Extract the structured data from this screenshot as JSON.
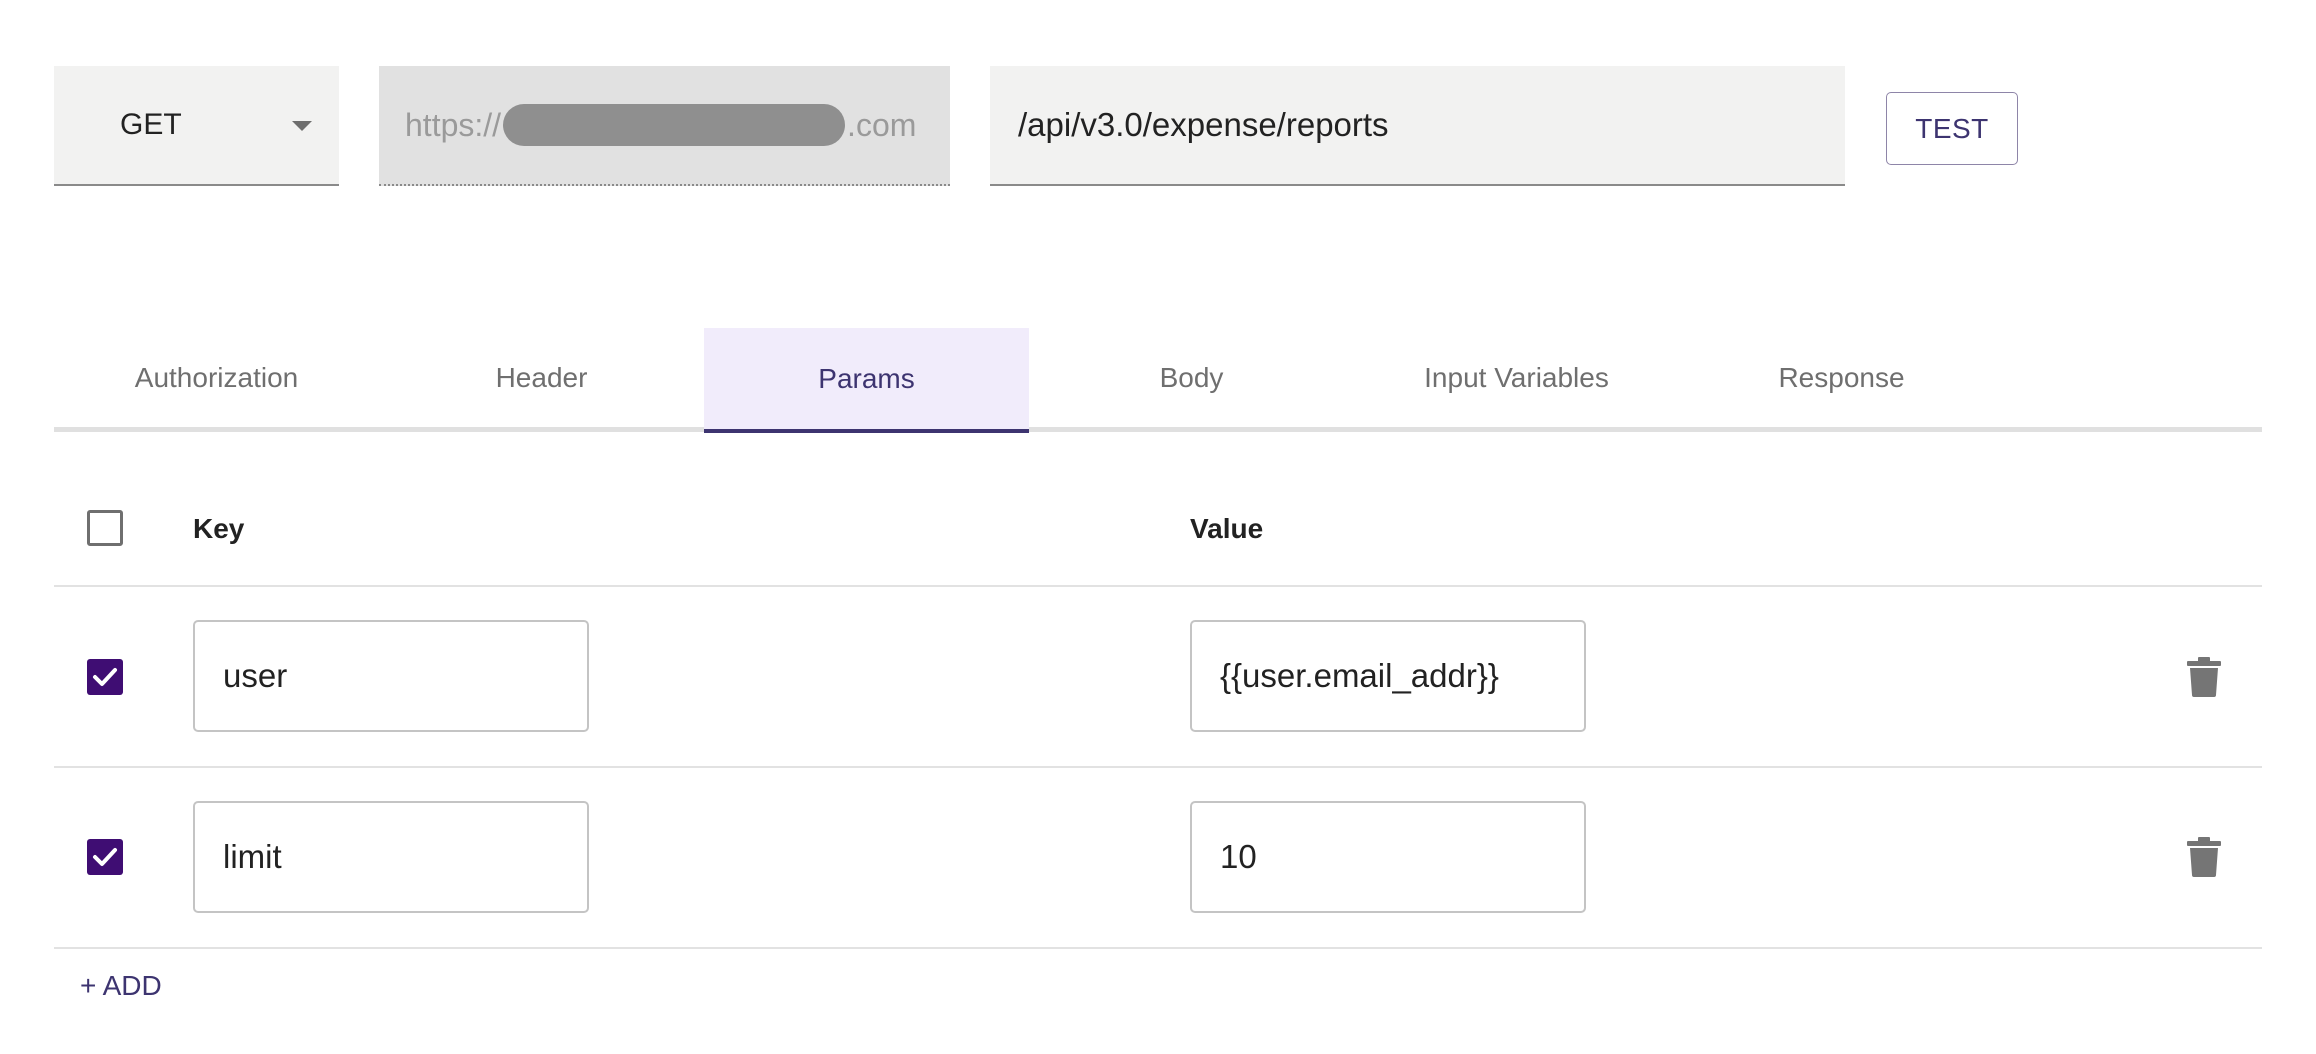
{
  "request": {
    "method": "GET",
    "base_url_prefix": "https://",
    "base_url_suffix": ".com",
    "path": "/api/v3.0/expense/reports",
    "test_label": "TEST"
  },
  "tabs": [
    {
      "label": "Authorization",
      "active": false
    },
    {
      "label": "Header",
      "active": false
    },
    {
      "label": "Params",
      "active": true
    },
    {
      "label": "Body",
      "active": false
    },
    {
      "label": "Input Variables",
      "active": false
    },
    {
      "label": "Response",
      "active": false
    }
  ],
  "params": {
    "headers": {
      "key": "Key",
      "value": "Value"
    },
    "rows": [
      {
        "checked": true,
        "key": "user",
        "value": "{{user.email_addr}}"
      },
      {
        "checked": true,
        "key": "limit",
        "value": "10"
      }
    ],
    "add_label": "+ ADD"
  },
  "icons": {
    "select_all": "checkbox-icon",
    "row_checked": "checkbox-checked-icon",
    "delete": "trash-icon",
    "dropdown": "caret-down-icon"
  },
  "colors": {
    "accent": "#3d3470",
    "checkbox_fill": "#3f0d73",
    "active_tab_bg": "#f1ecfb"
  }
}
